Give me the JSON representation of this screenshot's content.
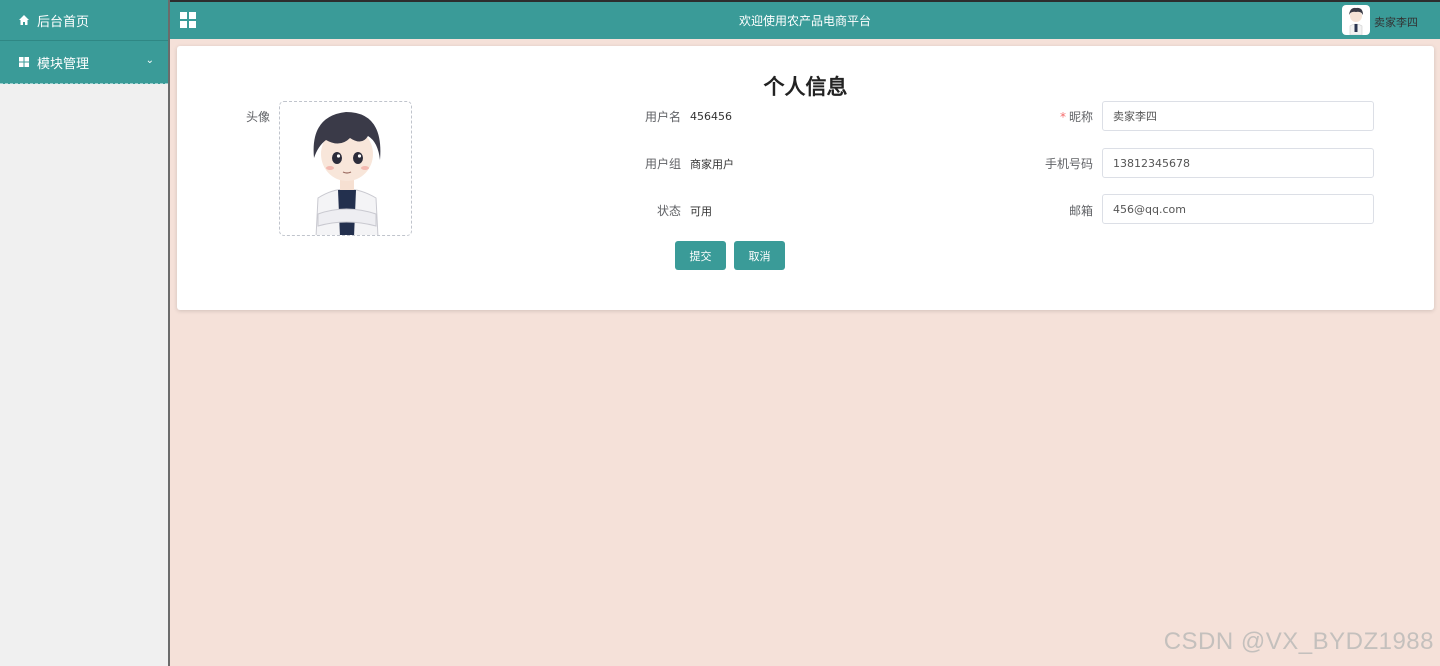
{
  "sidebar": {
    "items": [
      {
        "label": "后台首页",
        "icon": "home-icon"
      },
      {
        "label": "模块管理",
        "icon": "grid-icon",
        "chevron": "⌄"
      }
    ]
  },
  "topbar": {
    "title": "欢迎使用农产品电商平台",
    "username": "卖家李四",
    "menu_icon": "grid-menu-icon"
  },
  "profile": {
    "title": "个人信息",
    "avatar_label": "头像",
    "username_label": "用户名",
    "username_value": "456456",
    "group_label": "用户组",
    "group_value": "商家用户",
    "status_label": "状态",
    "status_value": "可用",
    "nickname_required": "*",
    "nickname_label": "昵称",
    "nickname_value": "卖家李四",
    "phone_label": "手机号码",
    "phone_value": "13812345678",
    "email_label": "邮箱",
    "email_value": "456@qq.com",
    "submit_label": "提交",
    "cancel_label": "取消"
  },
  "watermark": "CSDN @VX_BYDZ1988",
  "colors": {
    "accent": "#3a9b98",
    "background": "#f5e1d9",
    "required": "#f56c6c"
  }
}
